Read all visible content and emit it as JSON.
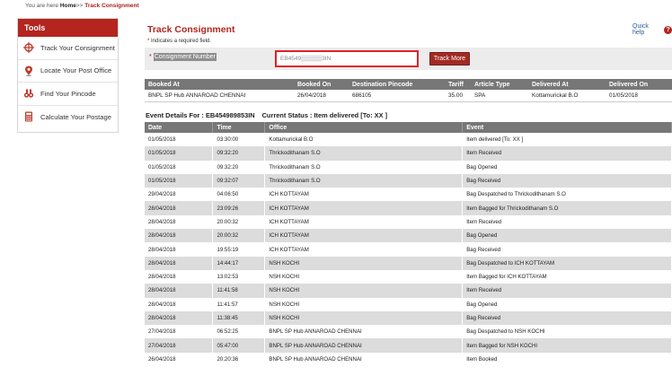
{
  "breadcrumb": {
    "prefix": "You are here",
    "home": "Home",
    "sep": ">>",
    "current": "Track Consignment"
  },
  "sidebar": {
    "title": "Tools",
    "items": [
      {
        "label": "Track Your Consignment",
        "icon": "crosshair-icon"
      },
      {
        "label": "Locate Your Post Office",
        "icon": "map-pin-icon"
      },
      {
        "label": "Find Your Pincode",
        "icon": "binoculars-icon"
      },
      {
        "label": "Calculate Your Postage",
        "icon": "calculator-icon"
      }
    ]
  },
  "main": {
    "title": "Track Consignment",
    "required_note": "Indicates a required field.",
    "required_star": "*",
    "quick_help": "Quick help",
    "quick_help_icon": "?",
    "form": {
      "label": "Consignment Number",
      "input_value": "EB4549▒▒▒▒▒3IN",
      "button": "Track More"
    }
  },
  "booking": {
    "headers": [
      "Booked At",
      "Booked On",
      "Destination Pincode",
      "Tariff",
      "Article Type",
      "Delivered At",
      "Delivered On"
    ],
    "row": [
      "BNPL SP Hub ANNAROAD CHENNAI",
      "26/04/2018",
      "686105",
      "35.00",
      "SPA",
      "Kottamurickal B.O",
      "01/05/2018"
    ]
  },
  "event_summary": {
    "details_label": "Event Details For : EB454989853IN",
    "status_label": "Current Status : Item delivered [To: XX ]"
  },
  "events": {
    "headers": [
      "Date",
      "Time",
      "Office",
      "Event"
    ],
    "rows": [
      [
        "01/05/2018",
        "03:30:00",
        "Kottamurickal B.O",
        "Item delivered [To: XX ]"
      ],
      [
        "01/05/2018",
        "09:32:20",
        "Thrickodithanam S.O",
        "Item Received"
      ],
      [
        "01/05/2018",
        "09:32:20",
        "Thrickodithanam S.O",
        "Bag Opened"
      ],
      [
        "01/05/2018",
        "09:32:07",
        "Thrickodithanam S.O",
        "Bag Received"
      ],
      [
        "29/04/2018",
        "04:06:50",
        "ICH KOTTAYAM",
        "Bag Despatched to Thrickodithanam S.O"
      ],
      [
        "28/04/2018",
        "23:09:26",
        "ICH KOTTAYAM",
        "Item Bagged for Thrickodithanam S.O"
      ],
      [
        "28/04/2018",
        "20:00:32",
        "ICH KOTTAYAM",
        "Item Received"
      ],
      [
        "28/04/2018",
        "20:00:32",
        "ICH KOTTAYAM",
        "Bag Opened"
      ],
      [
        "28/04/2018",
        "19:55:19",
        "ICH KOTTAYAM",
        "Bag Received"
      ],
      [
        "28/04/2018",
        "14:44:17",
        "NSH KOCHI",
        "Bag Despatched to ICH KOTTAYAM"
      ],
      [
        "28/04/2018",
        "13:02:53",
        "NSH KOCHI",
        "Item Bagged for ICH KOTTAYAM"
      ],
      [
        "28/04/2018",
        "11:41:58",
        "NSH KOCHI",
        "Item Received"
      ],
      [
        "28/04/2018",
        "11:41:57",
        "NSH KOCHI",
        "Bag Opened"
      ],
      [
        "28/04/2018",
        "11:38:45",
        "NSH KOCHI",
        "Bag Received"
      ],
      [
        "27/04/2018",
        "06:52:25",
        "BNPL SP Hub ANNAROAD CHENNAI",
        "Bag Despatched to NSH KOCHI"
      ],
      [
        "27/04/2018",
        "05:47:00",
        "BNPL SP Hub ANNAROAD CHENNAI",
        "Item Bagged for NSH KOCHI"
      ],
      [
        "26/04/2018",
        "20:20:36",
        "BNPL SP Hub ANNAROAD CHENNAI",
        "Item Booked"
      ]
    ]
  },
  "colors": {
    "brand_red": "#b3251e",
    "header_gray": "#777777",
    "stripe": "#dddcdc",
    "input_border": "#e0212b"
  }
}
